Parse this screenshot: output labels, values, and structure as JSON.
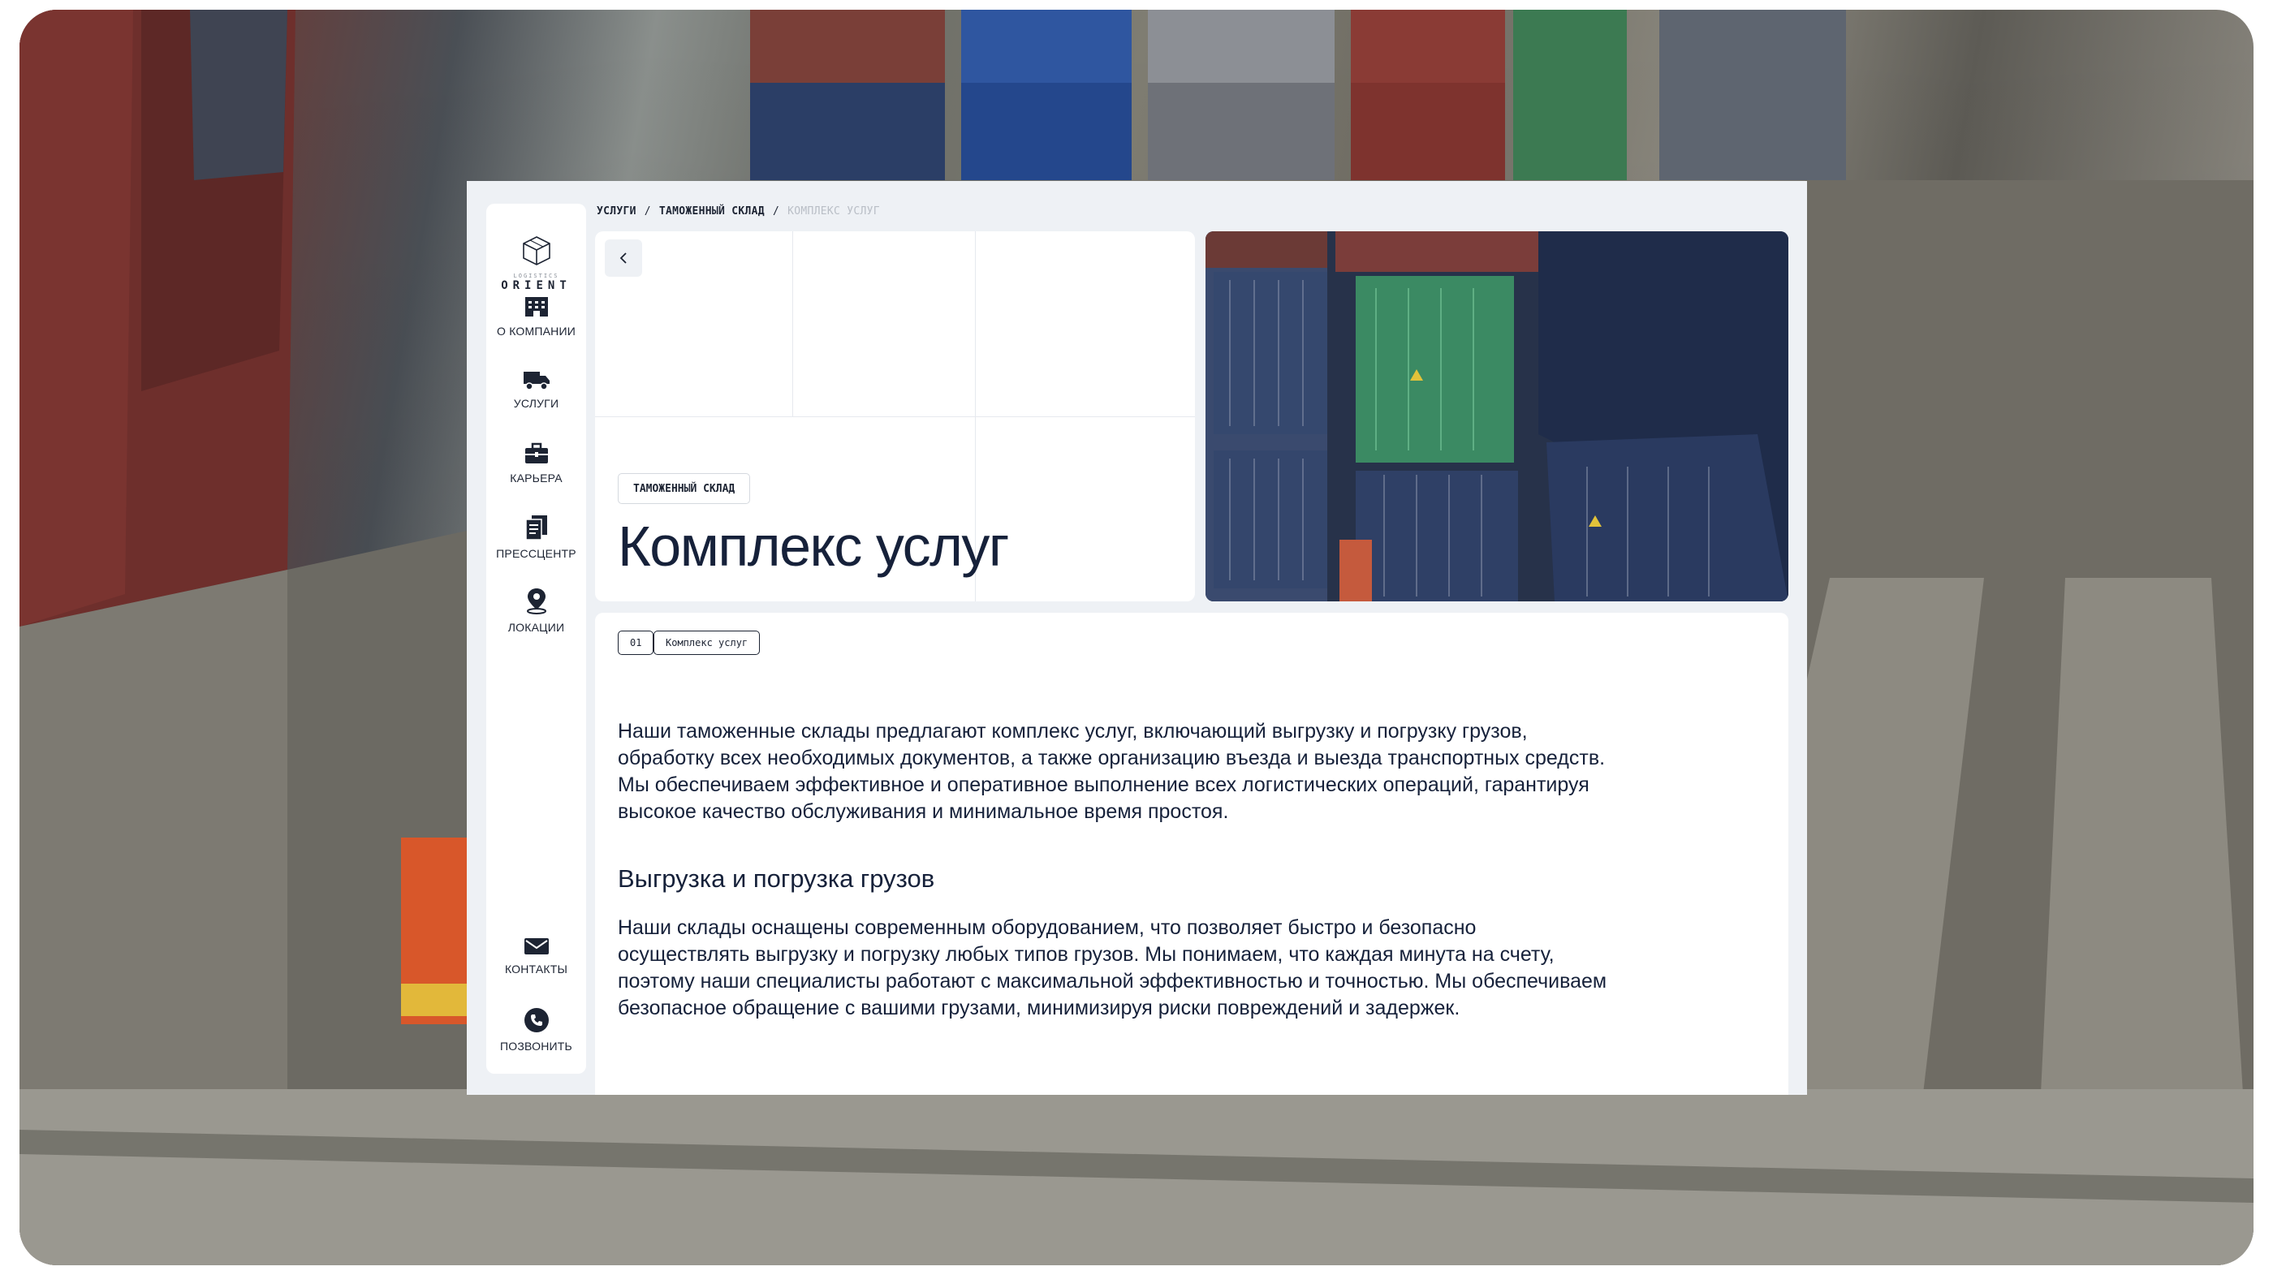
{
  "sidebar": {
    "logo": {
      "subtitle": "LOGISTICS",
      "name": "ORIENT"
    },
    "items": [
      {
        "label": "О КОМПАНИИ",
        "icon": "building-icon"
      },
      {
        "label": "УСЛУГИ",
        "icon": "truck-icon"
      },
      {
        "label": "КАРЬЕРА",
        "icon": "briefcase-icon"
      },
      {
        "label": "ПРЕССЦЕНТР",
        "icon": "documents-icon"
      },
      {
        "label": "ЛОКАЦИИ",
        "icon": "location-pin-icon"
      }
    ],
    "bottom_items": [
      {
        "label": "КОНТАКТЫ",
        "icon": "mail-icon"
      },
      {
        "label": "ПОЗВОНИТЬ",
        "icon": "phone-icon"
      }
    ]
  },
  "breadcrumb": {
    "items": [
      "УСЛУГИ",
      "ТАМОЖЕННЫЙ СКЛАД",
      "КОМПЛЕКС УСЛУГ"
    ],
    "separator": "/"
  },
  "hero": {
    "tag": "ТАМОЖЕННЫЙ СКЛАД",
    "title": "Комплекс услуг"
  },
  "content": {
    "chip_number": "01",
    "chip_label": "Комплекс услуг",
    "intro": "Наши таможенные склады предлагают комплекс услуг, включающий выгрузку и погрузку грузов, обработку всех необходимых документов, а также организацию въезда и выезда транспортных средств. Мы обеспечиваем эффективное и оперативное выполнение всех логистических операций, гарантируя высокое качество обслуживания и минимальное время простоя.",
    "section_title": "Выгрузка и погрузка грузов",
    "section_text": "Наши склады оснащены современным оборудованием, что позволяет быстро и безопасно осуществлять выгрузку и погрузку любых типов грузов. Мы понимаем, что каждая минута на счету, поэтому наши специалисты работают с максимальной эффективностью и точностью. Мы обеспечиваем безопасное обращение с вашими грузами, минимизируя риски повреждений и задержек."
  },
  "colors": {
    "text_dark": "#16213a",
    "window_bg": "#eef1f5",
    "card_bg": "#ffffff",
    "muted": "#b9bec6"
  }
}
